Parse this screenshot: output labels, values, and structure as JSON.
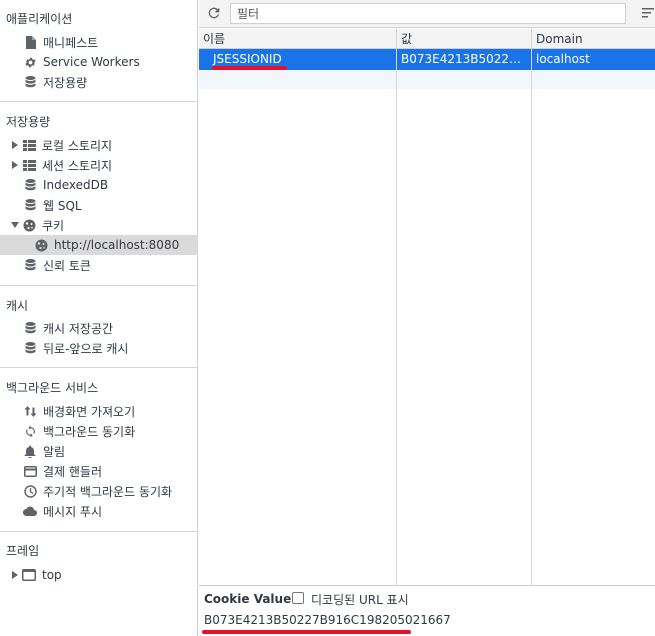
{
  "sidebar": {
    "application": {
      "title": "애플리케이션",
      "items": [
        {
          "label": "매니페스트",
          "icon": "file-icon"
        },
        {
          "label": "Service Workers",
          "icon": "gear-icon"
        },
        {
          "label": "저장용량",
          "icon": "database-icon"
        }
      ]
    },
    "storage": {
      "title": "저장용량",
      "items": [
        {
          "label": "로컬 스토리지",
          "icon": "grid-icon"
        },
        {
          "label": "세션 스토리지",
          "icon": "grid-icon"
        },
        {
          "label": "IndexedDB",
          "icon": "database-icon"
        },
        {
          "label": "웹 SQL",
          "icon": "database-icon"
        },
        {
          "label": "쿠키",
          "icon": "cookie-icon"
        },
        {
          "label": "http://localhost:8080",
          "icon": "cookie-icon"
        },
        {
          "label": "신뢰 토큰",
          "icon": "database-icon"
        }
      ]
    },
    "cache": {
      "title": "캐시",
      "items": [
        {
          "label": "캐시 저장공간",
          "icon": "database-icon"
        },
        {
          "label": "뒤로-앞으로 캐시",
          "icon": "database-icon"
        }
      ]
    },
    "background": {
      "title": "백그라운드 서비스",
      "items": [
        {
          "label": "배경화면 가져오기",
          "icon": "up-down-arrows-icon"
        },
        {
          "label": "백그라운드 동기화",
          "icon": "sync-icon"
        },
        {
          "label": "알림",
          "icon": "bell-icon"
        },
        {
          "label": "결제 핸들러",
          "icon": "card-icon"
        },
        {
          "label": "주기적 백그라운드 동기화",
          "icon": "clock-icon"
        },
        {
          "label": "메시지 푸시",
          "icon": "cloud-icon"
        }
      ]
    },
    "frames": {
      "title": "프레임",
      "items": [
        {
          "label": "top",
          "icon": "window-icon"
        }
      ]
    }
  },
  "toolbar": {
    "filter_placeholder": "필터"
  },
  "table": {
    "columns": [
      "이름",
      "값",
      "Domain"
    ],
    "rows": [
      {
        "name": "JSESSIONID",
        "value": "B073E4213B50227B916C198205021667",
        "domain": "localhost"
      }
    ]
  },
  "bottom": {
    "title": "Cookie Value",
    "checkbox_label": "디코딩된 URL 표시",
    "value": "B073E4213B50227B916C198205021667"
  },
  "colors": {
    "selection": "#1a73e8",
    "annotation": "#e8112d"
  }
}
